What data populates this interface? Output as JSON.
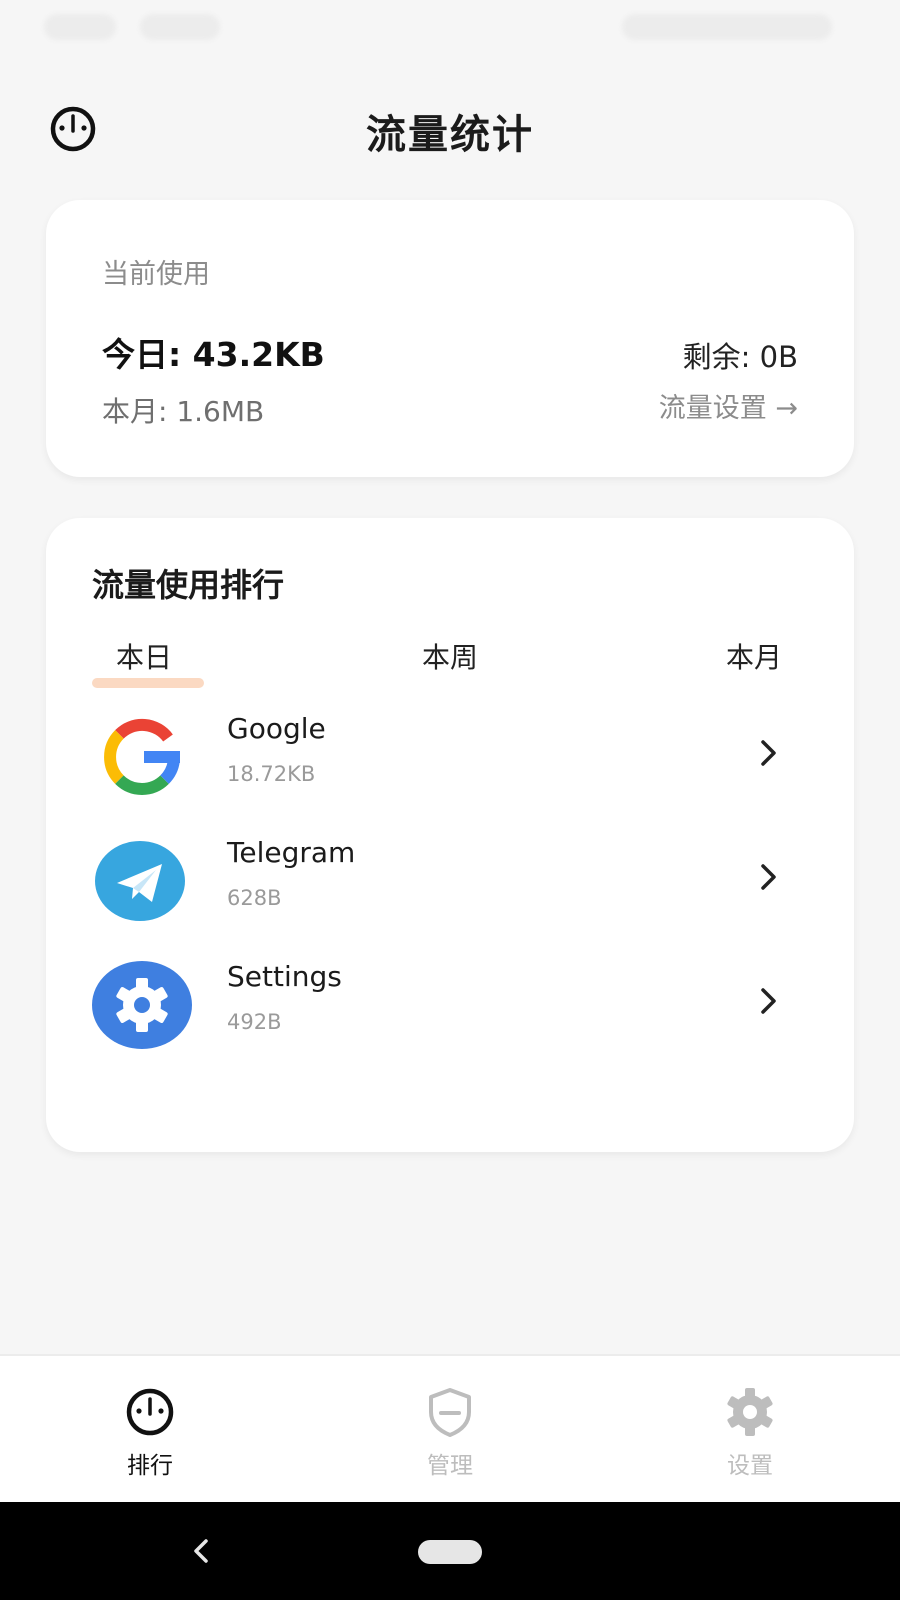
{
  "header": {
    "title": "流量统计",
    "menu_icon": "gauge-icon"
  },
  "usage_card": {
    "label": "当前使用",
    "today": "今日: 43.2KB",
    "remaining": "剩余: 0B",
    "month": "本月: 1.6MB",
    "settings_link": "流量设置 →"
  },
  "ranking": {
    "heading": "流量使用排行",
    "tabs": [
      {
        "label": "本日",
        "selected": true
      },
      {
        "label": "本周",
        "selected": false
      },
      {
        "label": "本月",
        "selected": false
      }
    ],
    "accent_color": "#fbd9c2",
    "apps": [
      {
        "name": "Google",
        "size": "18.72KB",
        "icon": "google-icon"
      },
      {
        "name": "Telegram",
        "size": "628B",
        "icon": "telegram-icon"
      },
      {
        "name": "Settings",
        "size": "492B",
        "icon": "settings-gear-icon"
      }
    ]
  },
  "bottom_nav": {
    "items": [
      {
        "label": "排行",
        "icon": "gauge-icon",
        "active": true
      },
      {
        "label": "管理",
        "icon": "shield-icon",
        "active": false
      },
      {
        "label": "设置",
        "icon": "gear-icon",
        "active": false
      }
    ],
    "active_color": "#111111",
    "inactive_color": "#bdbdbd"
  }
}
